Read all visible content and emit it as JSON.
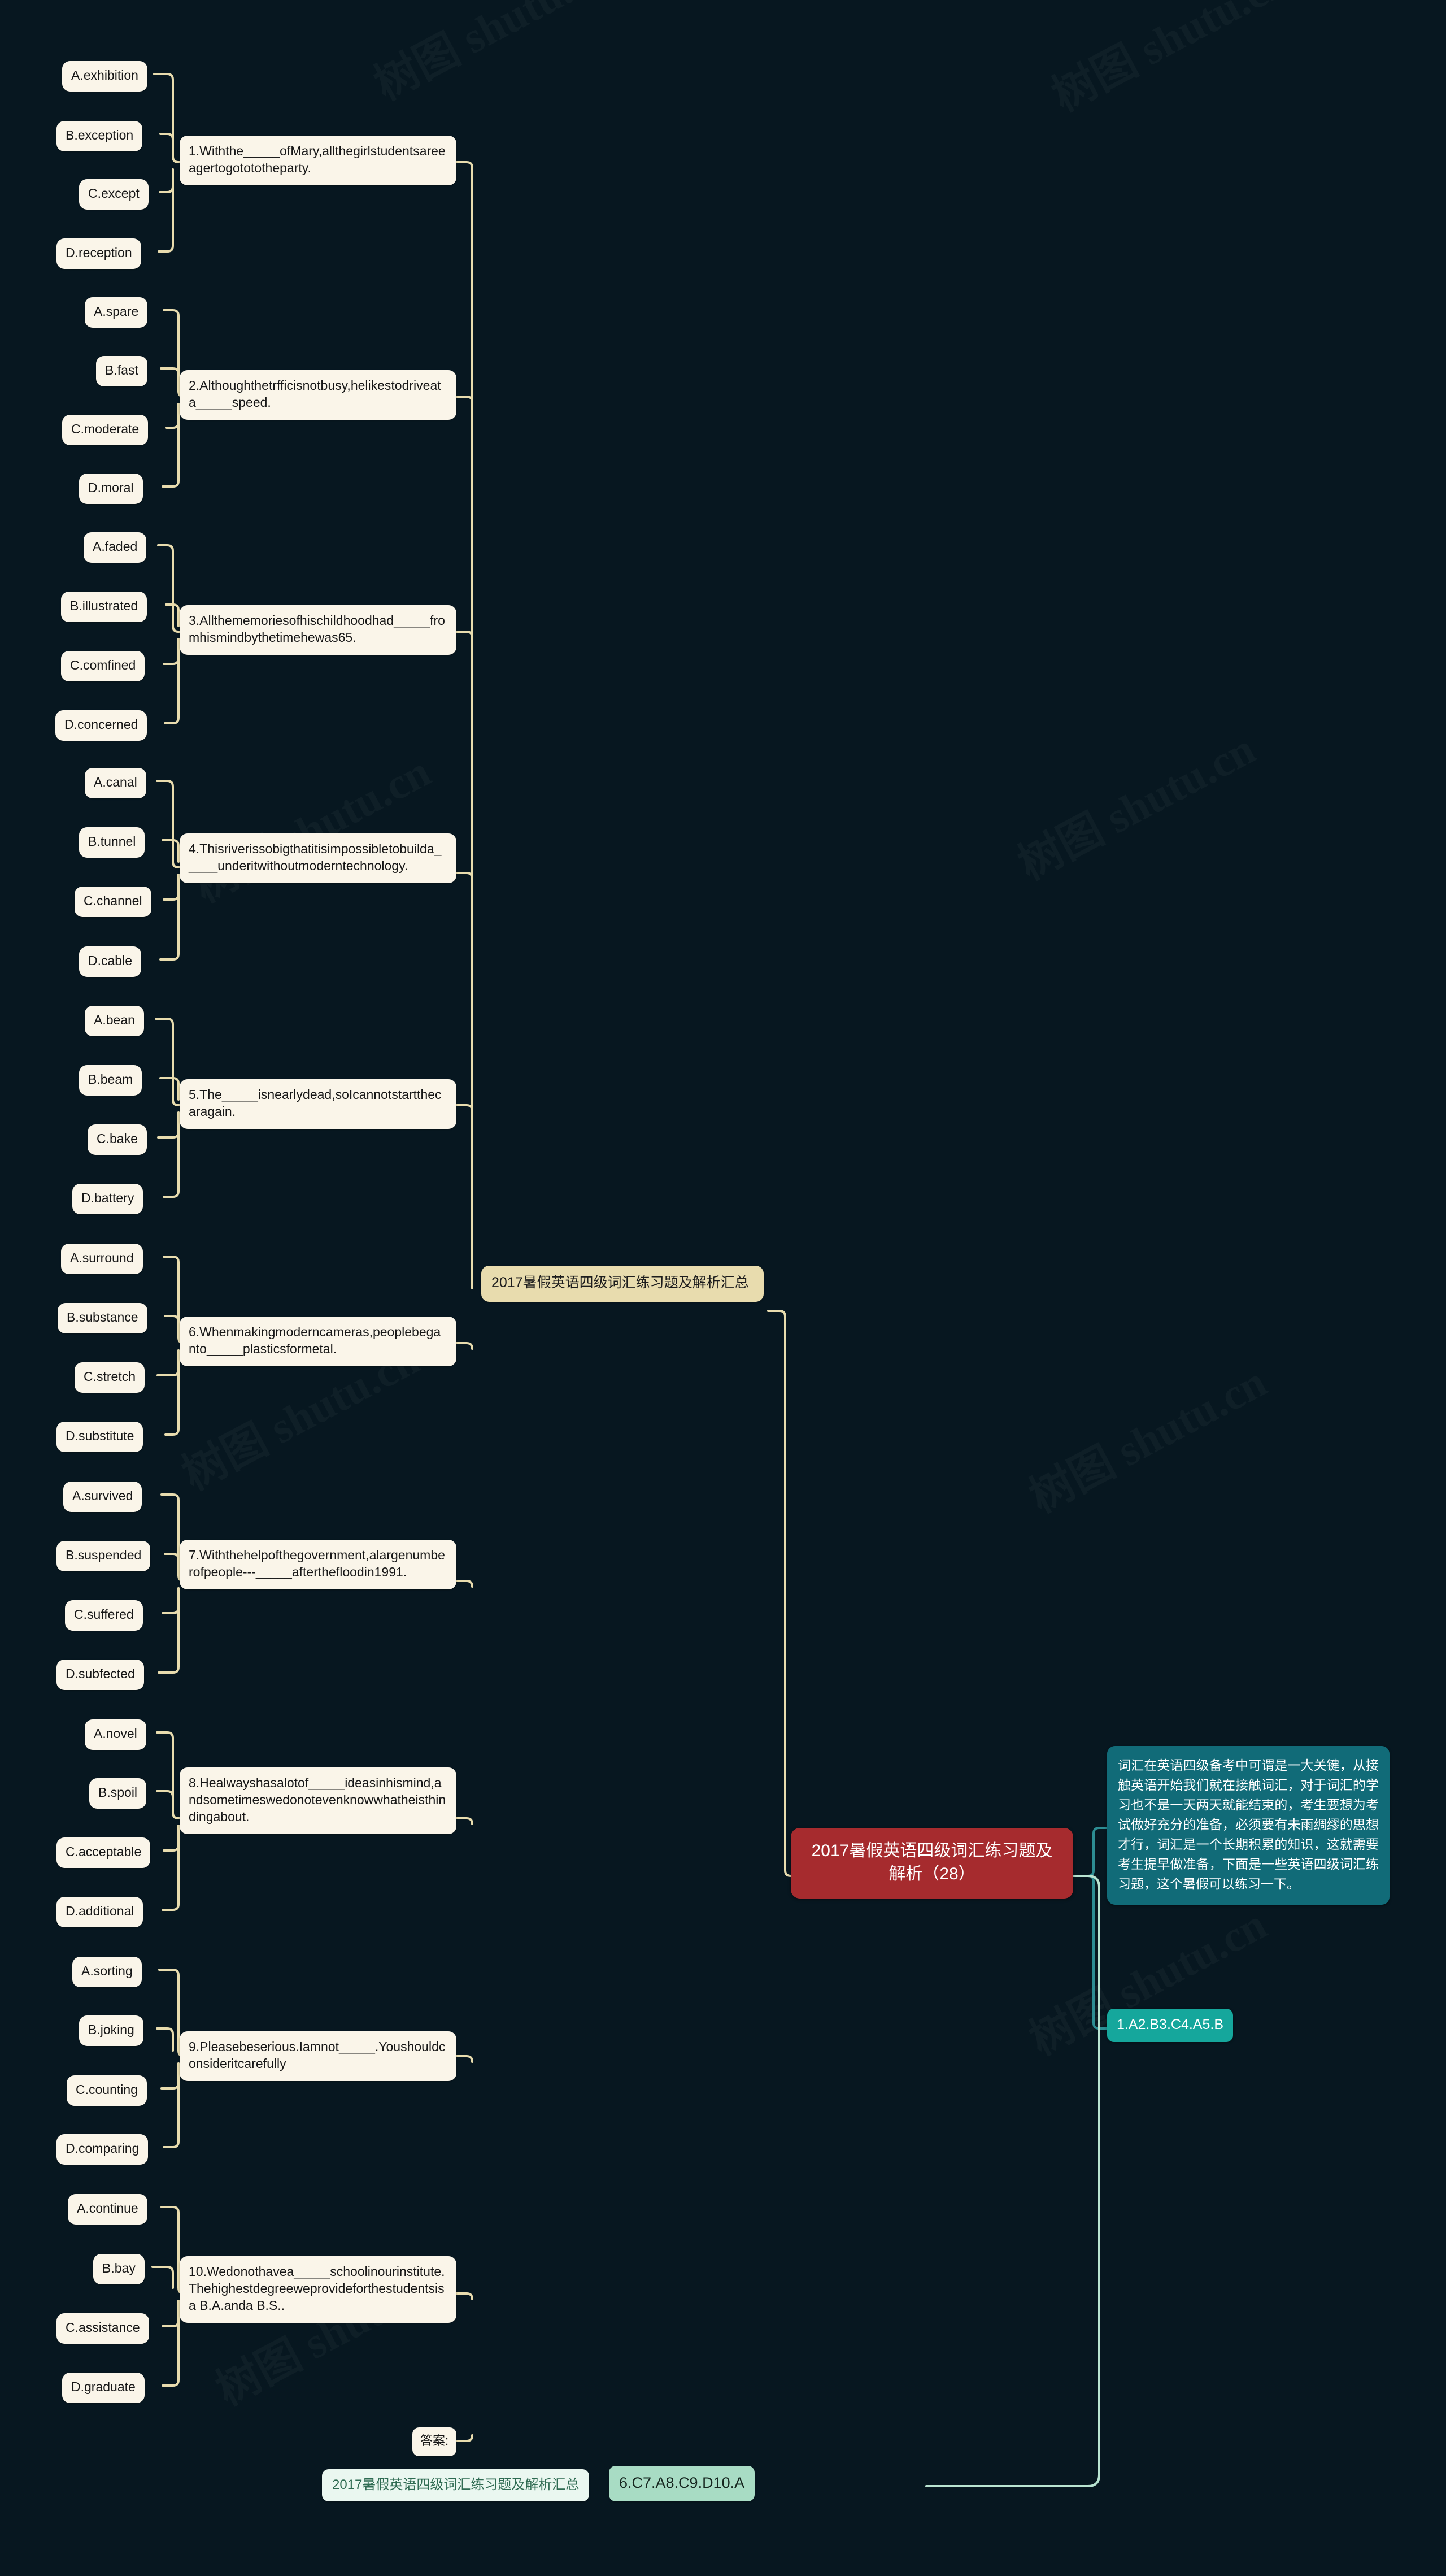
{
  "root": {
    "title": "2017暑假英语四级词汇练习题及解析（28）",
    "color": "#a62b2e"
  },
  "intro": {
    "text": "词汇在英语四级备考中可谓是一大关键，从接触英语开始我们就在接触词汇，对于词汇的学习也不是一天两天就能结束的，考生要想为考试做好充分的准备，必须要有未雨绸缪的思想才行，词汇是一个长期积累的知识，这就需要考生提早做准备，下面是一些英语四级词汇练习题，这个暑假可以练习一下。",
    "color": "#116b78"
  },
  "answers_top": {
    "label": "1.A2.B3.C4.A5.B",
    "color": "#15a79c"
  },
  "summary_chip": {
    "label": "2017暑假英语四级词汇练习题及解析汇总",
    "color": "#e8dcae"
  },
  "answer_section": {
    "label": "答案:",
    "title_chip": "2017暑假英语四级词汇练习题及解析汇总",
    "answers": "6.C7.A8.C9.D10.A",
    "title_chip_color": "#eaf7f0",
    "answers_color": "#a8dcc4"
  },
  "questions": [
    {
      "text": "1.Withthe_____ofMary,allthegirlstudentsareeagertogotototheparty.",
      "options": [
        "A.exhibition",
        "B.exception",
        "C.except",
        "D.reception"
      ]
    },
    {
      "text": "2.Althoughthetrfficisnotbusy,helikestodriveata_____speed.",
      "options": [
        "A.spare",
        "B.fast",
        "C.moderate",
        "D.moral"
      ]
    },
    {
      "text": "3.Allthememoriesofhischildhoodhad_____fromhismindbythetimehewas65.",
      "options": [
        "A.faded",
        "B.illustrated",
        "C.comfined",
        "D.concerned"
      ]
    },
    {
      "text": "4.Thisriverissobigthatitisimpossibletobuilda_____underitwithoutmoderntechnology.",
      "options": [
        "A.canal",
        "B.tunnel",
        "C.channel",
        "D.cable"
      ]
    },
    {
      "text": "5.The_____isnearlydead,soIcannotstartthecaragain.",
      "options": [
        "A.bean",
        "B.beam",
        "C.bake",
        "D.battery"
      ]
    },
    {
      "text": "6.Whenmakingmoderncameras,peoplebeganto_____plasticsformetal.",
      "options": [
        "A.surround",
        "B.substance",
        "C.stretch",
        "D.substitute"
      ]
    },
    {
      "text": "7.Withthehelpofthegovernment,alargenumberofpeople---_____afterthefloodin1991.",
      "options": [
        "A.survived",
        "B.suspended",
        "C.suffered",
        "D.subfected"
      ]
    },
    {
      "text": "8.Healwayshasalotof_____ideasinhismind,andsometimeswedonotevenknowwhatheisthindingabout.",
      "options": [
        "A.novel",
        "B.spoil",
        "C.acceptable",
        "D.additional"
      ]
    },
    {
      "text": "9.Pleasebeserious.Iamnot_____.Youshouldconsideritcarefully",
      "options": [
        "A.sorting",
        "B.joking",
        "C.counting",
        "D.comparing"
      ]
    },
    {
      "text": "10.Wedonothavea_____schoolinourinstitute.Thehighestdegreeweprovideforthestudentsisa B.A.anda B.S..",
      "options": [
        "A.continue",
        "B.bay",
        "C.assistance",
        "D.graduate"
      ]
    }
  ],
  "watermarks": [
    "树图 shutu.cn",
    "树图 shutu.cn",
    "树图 shutu.cn",
    "树图 shutu.cn",
    "树图 shutu.cn",
    "树图 shutu.cn",
    "树图 shutu.cn",
    "树图 shutu.cn"
  ]
}
